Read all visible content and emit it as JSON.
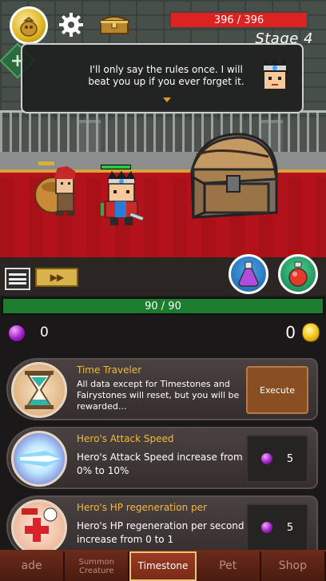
{
  "hud": {
    "hp_text": "396 / 396",
    "stage_text": "Stage 4"
  },
  "dialog": {
    "text": "I'll only say the rules once. I will beat you up if you ever forget it."
  },
  "controls": {
    "speed_label": "▶▶"
  },
  "panel": {
    "xp_text": "90 / 90",
    "gems": "0",
    "gold": "0"
  },
  "skills": [
    {
      "title": "Time Traveler",
      "desc": "All data except for Timestones and Fairystones will reset, but you will be rewarded...",
      "action_label": "Execute"
    },
    {
      "title": "Hero's Attack Speed",
      "desc": "Hero's Attack Speed increase from 0% to 10%",
      "cost": "5"
    },
    {
      "title": "Hero's HP regeneration per",
      "desc": "Hero's HP regeneration per second increase from 0 to 1",
      "cost": "5"
    }
  ],
  "tabs": [
    {
      "label": "ade"
    },
    {
      "label": "Summon Creature"
    },
    {
      "label": "Timestone"
    },
    {
      "label": "Pet"
    },
    {
      "label": "Shop"
    }
  ],
  "colors": {
    "hp_red": "#dd2222",
    "xp_green": "#1d7d2e",
    "skill_title": "#f2b93b",
    "carpet": "#b3121a"
  }
}
